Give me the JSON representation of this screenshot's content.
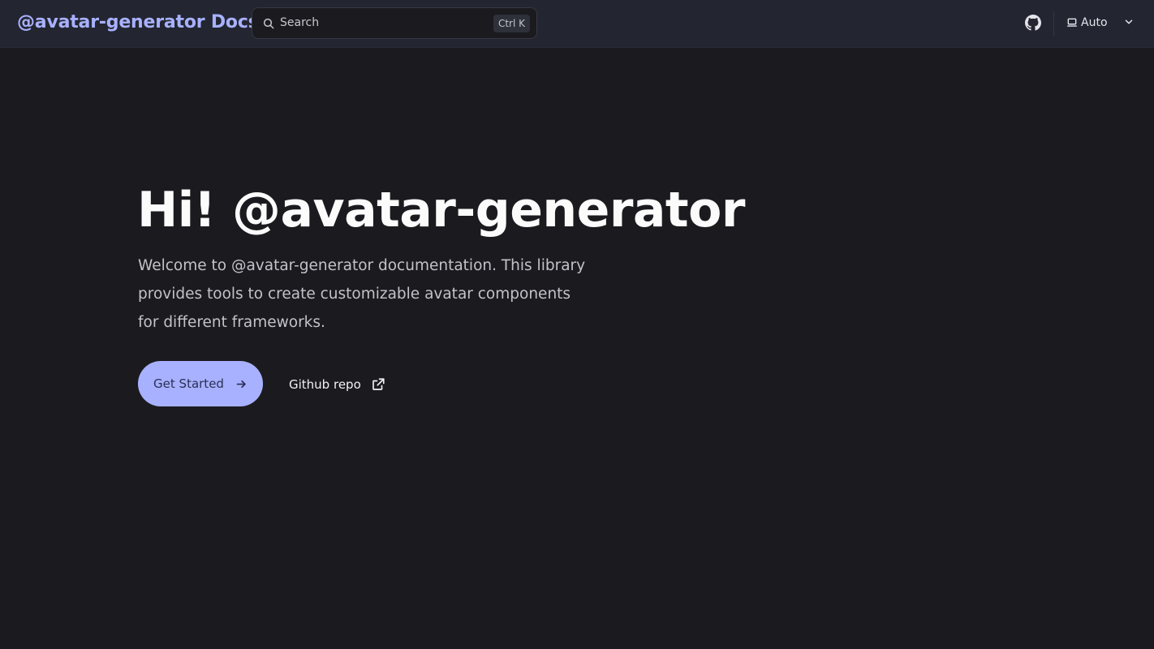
{
  "nav": {
    "brand": "@avatar-generator Docs",
    "search_placeholder": "Search",
    "search_shortcut": "Ctrl K",
    "github_icon": "github-icon",
    "appearance_label": "Auto",
    "appearance_icon": "monitor-icon"
  },
  "hero": {
    "title": "Hi! @avatar-generator",
    "description": "Welcome to @avatar-generator documentation. This library provides tools to create customizable avatar components for different frameworks.",
    "primary_action": "Get Started",
    "secondary_action": "Github repo"
  },
  "colors": {
    "accent": "#a8b1ff",
    "background": "#1b1b1f",
    "topbar": "#232530"
  }
}
